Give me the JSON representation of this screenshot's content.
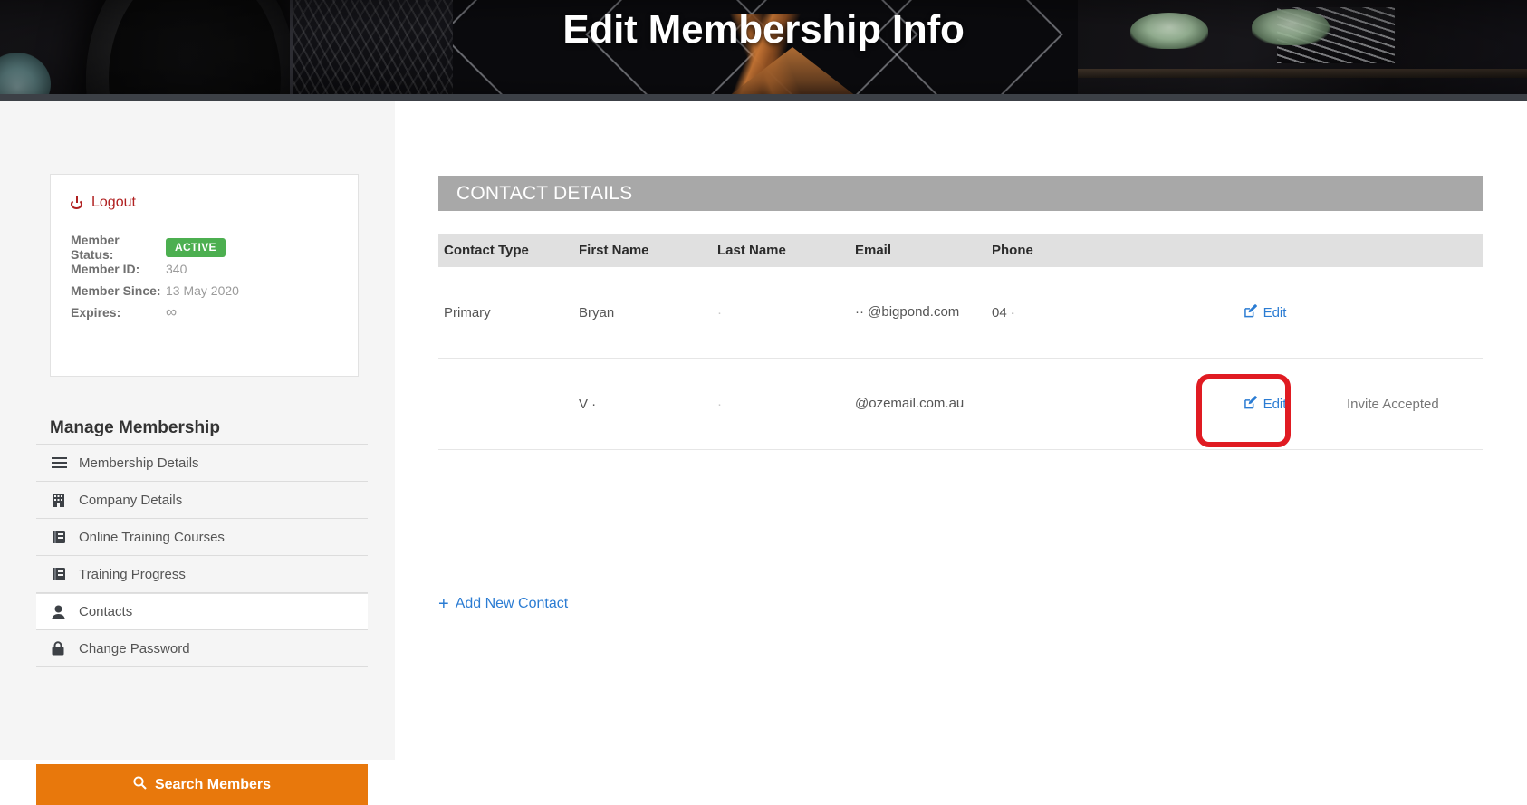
{
  "banner": {
    "title": "Edit Membership Info"
  },
  "sidebar": {
    "logout_label": "Logout",
    "logout_icon": "power-icon",
    "status": {
      "rows": [
        {
          "label": "Member Status:",
          "value": "ACTIVE"
        },
        {
          "label": "Member ID:",
          "value": "340"
        },
        {
          "label": "Member Since:",
          "value": "13 May 2020"
        },
        {
          "label": "Expires:",
          "value": "∞"
        }
      ],
      "badge_color": "#4caf50"
    },
    "menu_title": "Manage Membership",
    "items": [
      {
        "label": "Membership Details",
        "icon": "list-icon",
        "active": false
      },
      {
        "label": "Company Details",
        "icon": "building-icon",
        "active": false
      },
      {
        "label": "Online Training Courses",
        "icon": "book-icon",
        "active": false
      },
      {
        "label": "Training Progress",
        "icon": "book-icon",
        "active": false
      },
      {
        "label": "Contacts",
        "icon": "user-icon",
        "active": true
      },
      {
        "label": "Change Password",
        "icon": "lock-icon",
        "active": false
      }
    ],
    "search_button": {
      "label": "Search Members",
      "icon": "search-icon",
      "color": "#e8780c"
    }
  },
  "main": {
    "section_title": "CONTACT DETAILS",
    "columns": [
      "Contact Type",
      "First Name",
      "Last Name",
      "Email",
      "Phone",
      "",
      ""
    ],
    "rows": [
      {
        "contact_type": "Primary",
        "first_name": "Bryan",
        "last_name": "·",
        "email": "·· @bigpond.com",
        "phone": "04 ·",
        "edit_label": "Edit",
        "edit_icon": "pen-square-icon",
        "status": ""
      },
      {
        "contact_type": "",
        "first_name": "V ·",
        "last_name": "·",
        "email": "@ozemail.com.au",
        "phone": "",
        "edit_label": "Edit",
        "edit_icon": "pen-square-icon",
        "status": "Invite Accepted"
      }
    ],
    "add_contact_label": "Add New Contact",
    "add_contact_icon": "plus-icon",
    "link_color": "#2b7cd3"
  },
  "annotation": {
    "color": "#e01b22",
    "target": "edit-link-row-2"
  }
}
